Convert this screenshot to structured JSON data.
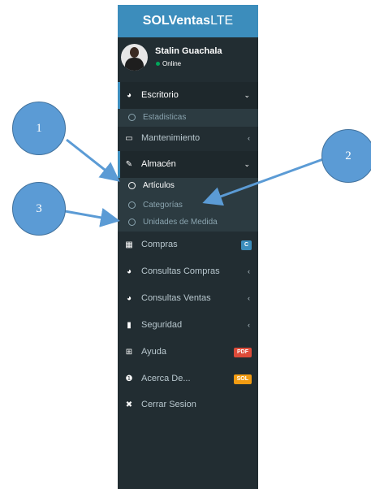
{
  "app": {
    "brand_bold": "SOLVentas",
    "brand_light": "LTE"
  },
  "user": {
    "name": "Stalin Guachala",
    "status": "Online"
  },
  "menu": {
    "escritorio": {
      "label": "Escritorio",
      "icon": "dashboard-icon",
      "sub": [
        {
          "label": "Estadisticas"
        }
      ]
    },
    "mantenimiento": {
      "label": "Mantenimiento",
      "icon": "laptop-icon"
    },
    "almacen": {
      "label": "Almacén",
      "icon": "edit-icon",
      "sub": [
        {
          "label": "Artículos"
        },
        {
          "label": "Categorías"
        },
        {
          "label": "Unidades de Medida"
        }
      ]
    },
    "compras": {
      "label": "Compras",
      "icon": "grid-icon",
      "badge": "C",
      "badge_color": "#3c8dbc"
    },
    "consultas_compras": {
      "label": "Consultas Compras",
      "icon": "pie-chart-icon"
    },
    "consultas_ventas": {
      "label": "Consultas Ventas",
      "icon": "pie-chart-icon"
    },
    "seguridad": {
      "label": "Seguridad",
      "icon": "folder-icon"
    },
    "ayuda": {
      "label": "Ayuda",
      "icon": "plus-square-icon",
      "badge": "PDF",
      "badge_color": "#dd4b39"
    },
    "acerca": {
      "label": "Acerca De...",
      "icon": "info-circle-icon",
      "badge": "SOL",
      "badge_color": "#f39c12"
    },
    "cerrar": {
      "label": "Cerrar Sesion",
      "icon": "close-icon"
    }
  },
  "callouts": [
    {
      "label": "1"
    },
    {
      "label": "2"
    },
    {
      "label": "3"
    }
  ],
  "colors": {
    "sidebar_bg": "#222d32",
    "brand_blue": "#3c8dbc",
    "callout_fill": "#5b9bd5"
  }
}
